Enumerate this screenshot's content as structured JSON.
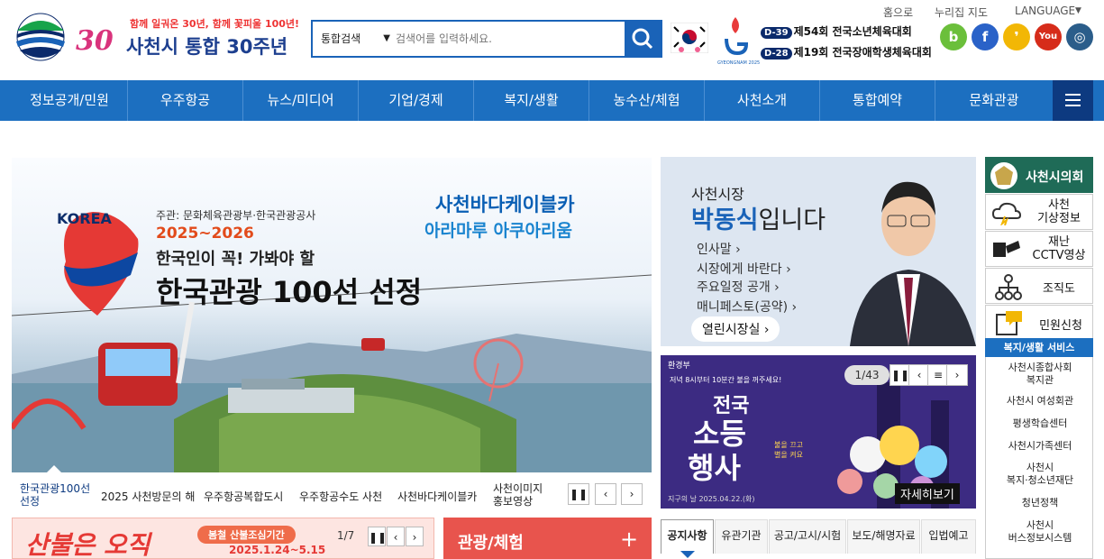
{
  "header": {
    "logo": {
      "number": "30",
      "slogan": "함께 일궈온 30년, 함께 꽃피울 100년!",
      "title": "사천시 통합 30주년"
    },
    "search": {
      "category": "통합검색",
      "placeholder": "검색어를 입력하세요."
    },
    "event_logo_text": "GYEONGNAM 2025",
    "ddays": [
      {
        "tag": "D-39",
        "text": "제54회 전국소년체육대회"
      },
      {
        "tag": "D-28",
        "text": "제19회 전국장애학생체육대회"
      }
    ],
    "util_links": [
      "홈으로",
      "누리집 지도",
      "LANGUAGE"
    ],
    "sns": [
      {
        "name": "blog-icon",
        "glyph": "b",
        "color": "#6bbf3b"
      },
      {
        "name": "facebook-icon",
        "glyph": "f",
        "color": "#2a62c8"
      },
      {
        "name": "kakaostory-icon",
        "glyph": "❜",
        "color": "#f2b705"
      },
      {
        "name": "youtube-icon",
        "glyph": "You",
        "color": "#d62c1a"
      },
      {
        "name": "instagram-icon",
        "glyph": "◎",
        "color": "#2b5d8a"
      }
    ]
  },
  "nav": {
    "items": [
      "정보공개/민원",
      "우주항공",
      "뉴스/미디어",
      "기업/경제",
      "복지/생활",
      "농수산/체험",
      "사천소개",
      "통합예약",
      "문화관광"
    ]
  },
  "hero": {
    "sub": "주관: 문화체육관광부·한국관광공사",
    "years": "2025~2026",
    "line1": "한국인이 꼭! 가봐야 할",
    "line2": "한국관광 100선 선정",
    "tag1": "사천바다케이블카",
    "tag2": "아라마루 아쿠아리움",
    "korea_text": "KOREA",
    "tabs": [
      "한국관광100선 선정",
      "2025 사천방문의 해",
      "우주항공복합도시",
      "우주항공수도 사천",
      "사천바다케이블카",
      "사천이미지 홍보영상"
    ]
  },
  "mayor": {
    "title": "사천시장",
    "name": "박동식",
    "suffix": "입니다",
    "links": [
      "인사말",
      "시장에게 바란다",
      "주요일정 공개",
      "매니페스토(공약)"
    ],
    "button": "열린시장실"
  },
  "banner2": {
    "ministry": "환경부",
    "top_notice": "저녁 8시부터 10분간 불을 꺼주세요!",
    "title_lines": [
      "전국",
      "소등",
      "행사"
    ],
    "bubble": "불을 끄고 별을 켜요",
    "date": "지구의 날 2025.04.22.(화)",
    "counter": "1/43",
    "more": "자세히보기"
  },
  "sidebar": {
    "council": "사천시의회",
    "items": [
      {
        "label": "사천\n기상정보",
        "icon": "weather-icon"
      },
      {
        "label": "재난\nCCTV영상",
        "icon": "cctv-icon"
      },
      {
        "label": "조직도",
        "icon": "org-chart-icon"
      },
      {
        "label": "민원신청",
        "icon": "petition-icon"
      }
    ],
    "welfare_header": "복지/생활 서비스",
    "welfare_links": [
      "사천시종합사회\n복지관",
      "사천시 여성회관",
      "평생학습센터",
      "사천시가족센터",
      "사천시\n복지·청소년재단",
      "청년정책",
      "사천시\n버스정보시스템"
    ]
  },
  "fire_banner": {
    "title": "산불은 오직",
    "period_label": "봄철 산불조심기간",
    "period": "2025.1.24~5.15",
    "counter": "1/7"
  },
  "tour": {
    "title": "관광/체험",
    "plus": "+"
  },
  "notice_tabs": [
    "공지사항",
    "유관기관",
    "공고/고시/시험",
    "보도/해명자료",
    "입법예고"
  ]
}
